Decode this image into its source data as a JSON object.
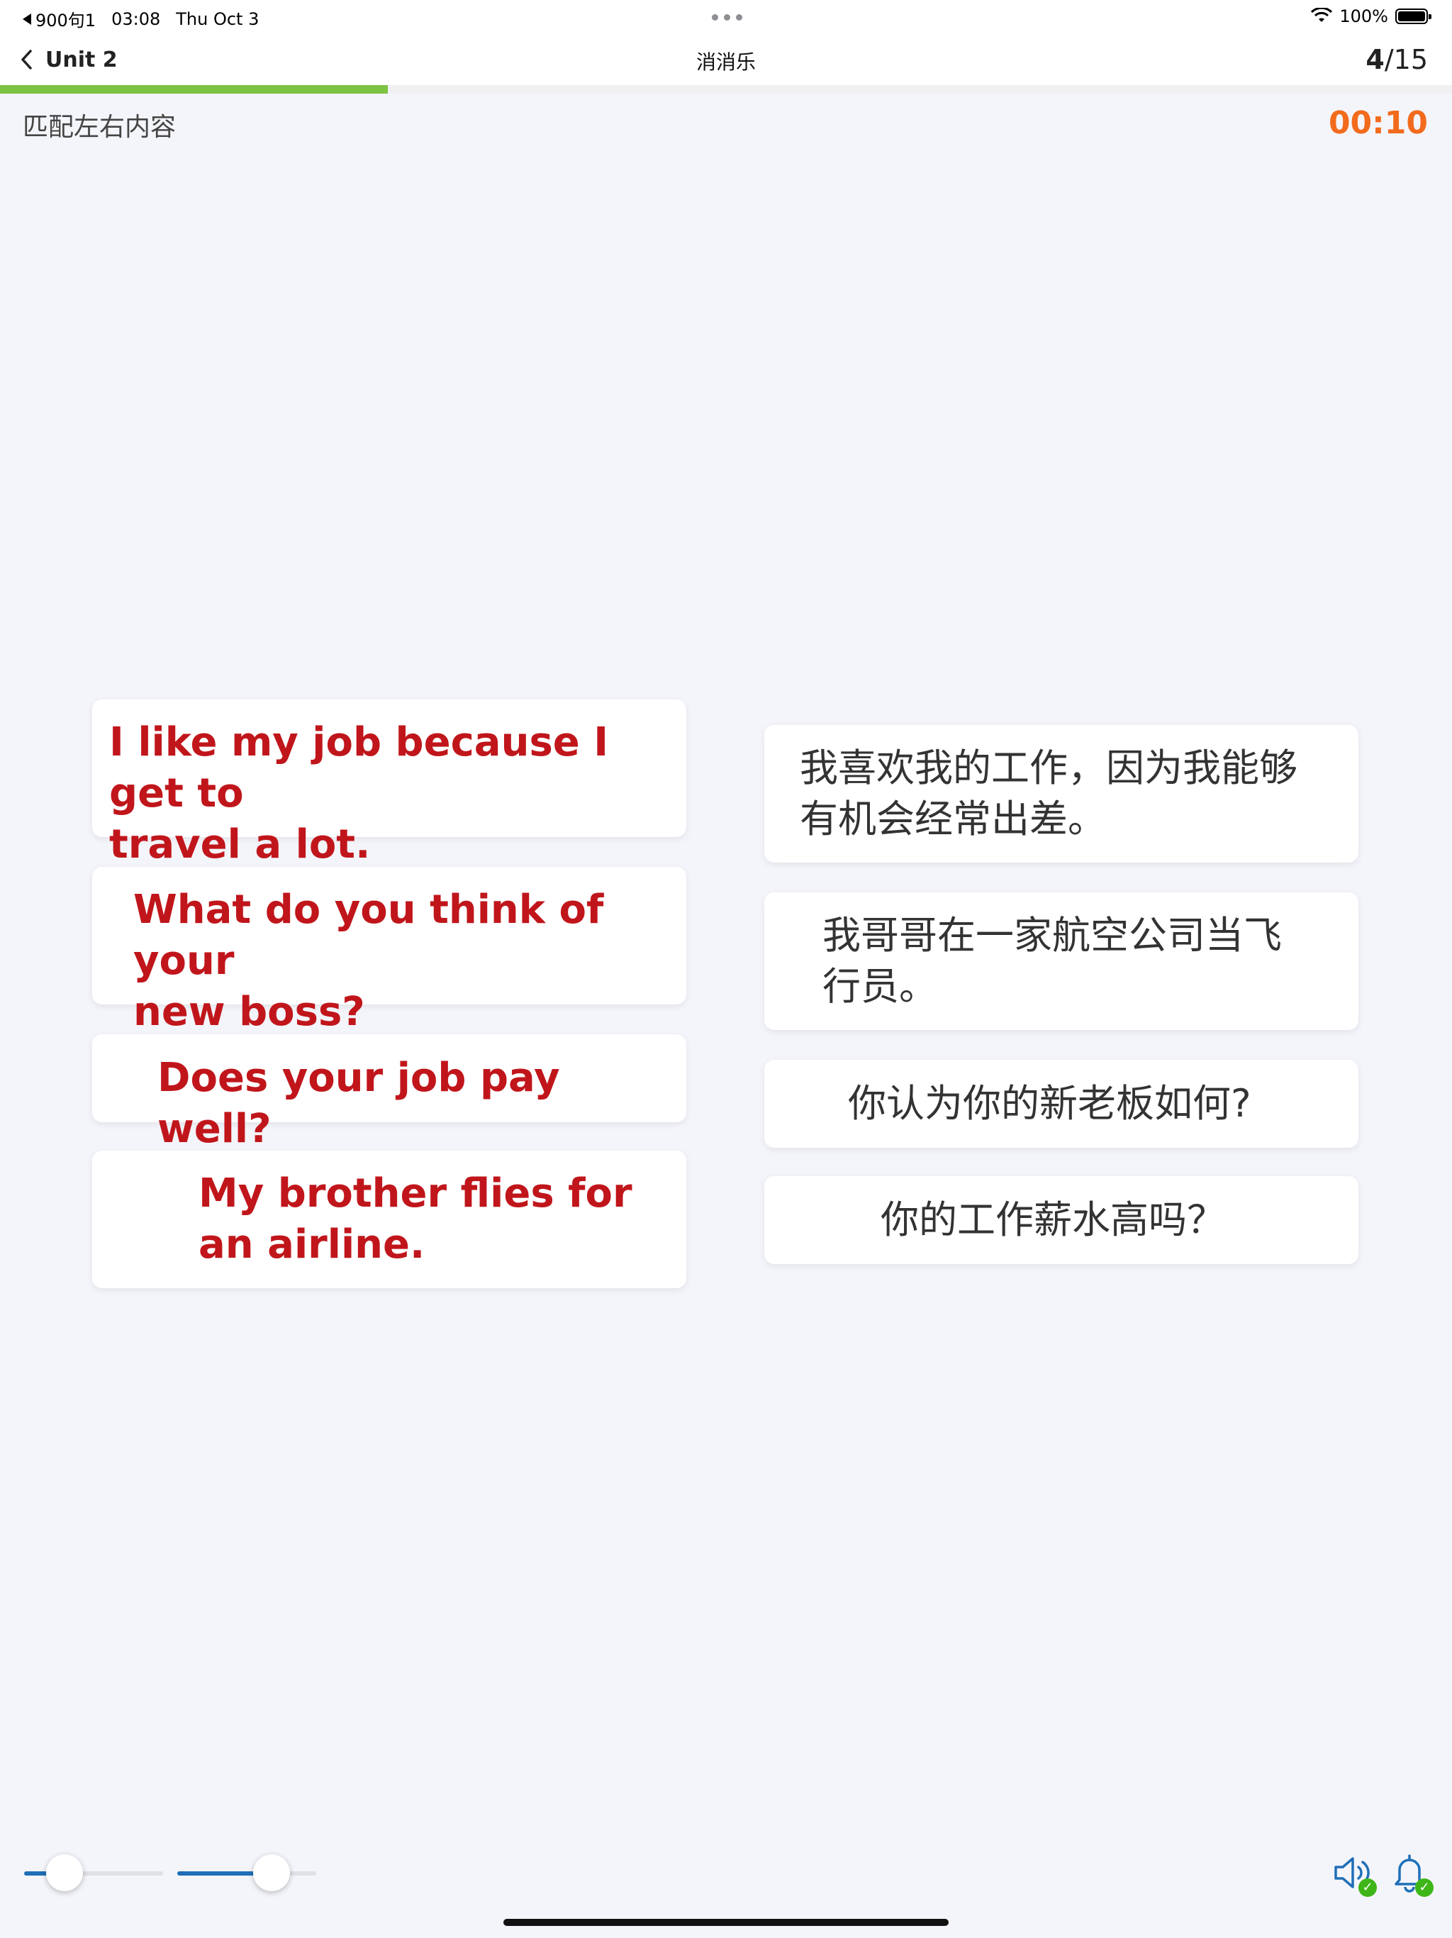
{
  "status_bar": {
    "carrier": "900句1",
    "time": "03:08",
    "date": "Thu Oct 3",
    "battery": "100%"
  },
  "nav": {
    "back_label": "Unit 2",
    "title": "消消乐",
    "current": "4",
    "total": "/15"
  },
  "progress": {
    "fraction": 0.267,
    "color": "#7dc242"
  },
  "instruction": "匹配左右内容",
  "timer": "00:10",
  "left_cards": [
    {
      "line1": "I like my job because I get to",
      "line2": "travel a lot."
    },
    {
      "line1": "What do you think of your",
      "line2": "new boss?"
    },
    {
      "line1": "Does your job pay well?",
      "line2": ""
    },
    {
      "line1": "My brother flies for",
      "line2": "an airline."
    }
  ],
  "right_cards": [
    {
      "line1": "我喜欢我的工作，因为我能够",
      "line2": "有机会经常出差。"
    },
    {
      "line1": "我哥哥在一家航空公司当飞",
      "line2": "行员。"
    },
    {
      "line1": "你认为你的新老板如何?",
      "line2": ""
    },
    {
      "line1": "你的工作薪水高吗？",
      "line2": ""
    }
  ],
  "sliders": [
    {
      "name": "speed",
      "value": 0.29
    },
    {
      "name": "volume",
      "value": 0.68
    }
  ],
  "colors": {
    "english_text": "#c0161b",
    "timer": "#f26b1d",
    "accent": "#1f6fb8",
    "check": "#3fb618"
  },
  "icons": {
    "speaker": "speaker-icon",
    "bell": "bell-icon"
  }
}
